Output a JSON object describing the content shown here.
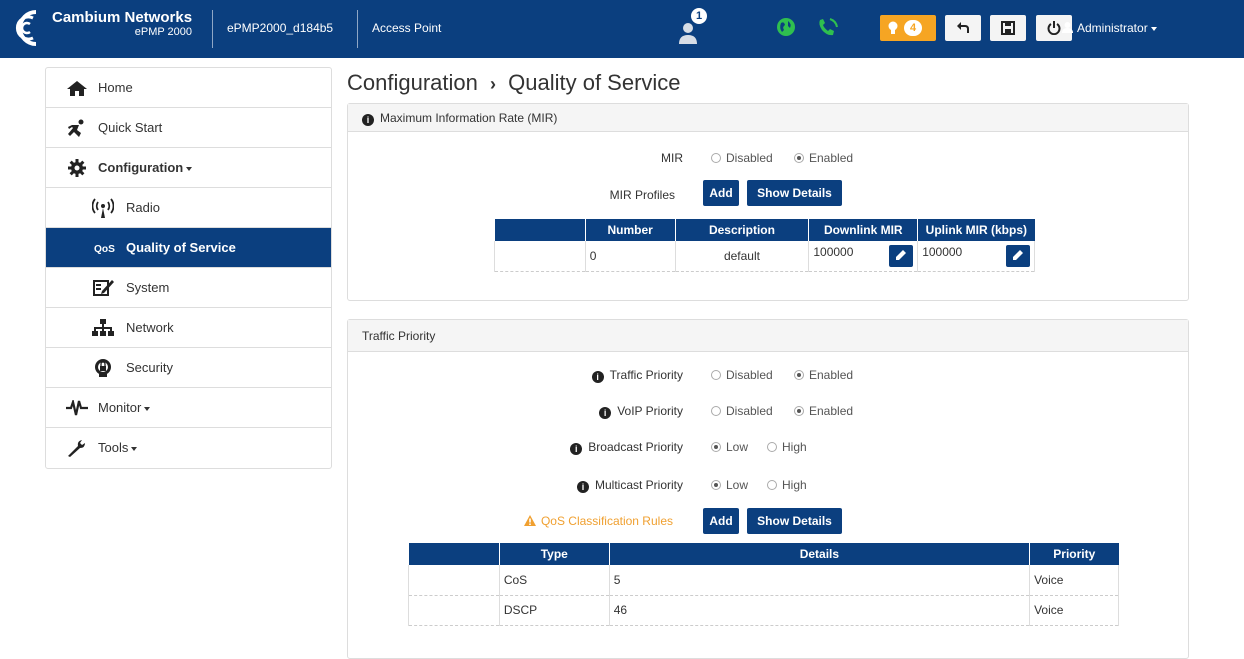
{
  "header": {
    "brand_name": "Cambium Networks",
    "brand_model": "ePMP 2000",
    "device_name": "ePMP2000_d184b5",
    "mode": "Access Point",
    "user_badge_count": "1",
    "alert_count": "4",
    "admin_label": "Administrator",
    "accent_color": "#0b3f7f",
    "alert_color": "#f6a523"
  },
  "sidebar": {
    "items": [
      {
        "label": "Home",
        "icon": "home-icon"
      },
      {
        "label": "Quick Start",
        "icon": "runner-icon"
      },
      {
        "label": "Configuration",
        "icon": "gear-icon"
      },
      {
        "label": "Radio",
        "icon": "radio-icon"
      },
      {
        "label": "Quality of Service",
        "icon": "qos-icon"
      },
      {
        "label": "System",
        "icon": "system-icon"
      },
      {
        "label": "Network",
        "icon": "network-icon"
      },
      {
        "label": "Security",
        "icon": "security-icon"
      },
      {
        "label": "Monitor",
        "icon": "pulse-icon"
      },
      {
        "label": "Tools",
        "icon": "wrench-icon"
      }
    ]
  },
  "page": {
    "breadcrumb_parent": "Configuration",
    "breadcrumb_sep": "›",
    "breadcrumb_current": "Quality of Service"
  },
  "mir": {
    "panel_title": "Maximum Information Rate (MIR)",
    "mir_label": "MIR",
    "disabled": "Disabled",
    "enabled": "Enabled",
    "selected": "Enabled",
    "profiles_label": "MIR Profiles",
    "add": "Add",
    "show_details": "Show Details",
    "columns": [
      "Number",
      "Description",
      "Downlink MIR",
      "Uplink MIR (kbps)"
    ],
    "rows": [
      {
        "number": "0",
        "description": "default",
        "downlink": "100000",
        "uplink": "100000"
      }
    ]
  },
  "traffic": {
    "panel_title": "Traffic Priority",
    "traffic_priority_label": "Traffic Priority",
    "voip_priority_label": "VoIP Priority",
    "broadcast_priority_label": "Broadcast Priority",
    "multicast_priority_label": "Multicast Priority",
    "disabled": "Disabled",
    "enabled": "Enabled",
    "low": "Low",
    "high": "High",
    "rules_label": "QoS Classification Rules",
    "add": "Add",
    "show_details": "Show Details",
    "columns": [
      "Type",
      "Details",
      "Priority"
    ],
    "rows": [
      {
        "type": "CoS",
        "details": "5",
        "priority": "Voice"
      },
      {
        "type": "DSCP",
        "details": "46",
        "priority": "Voice"
      }
    ]
  }
}
